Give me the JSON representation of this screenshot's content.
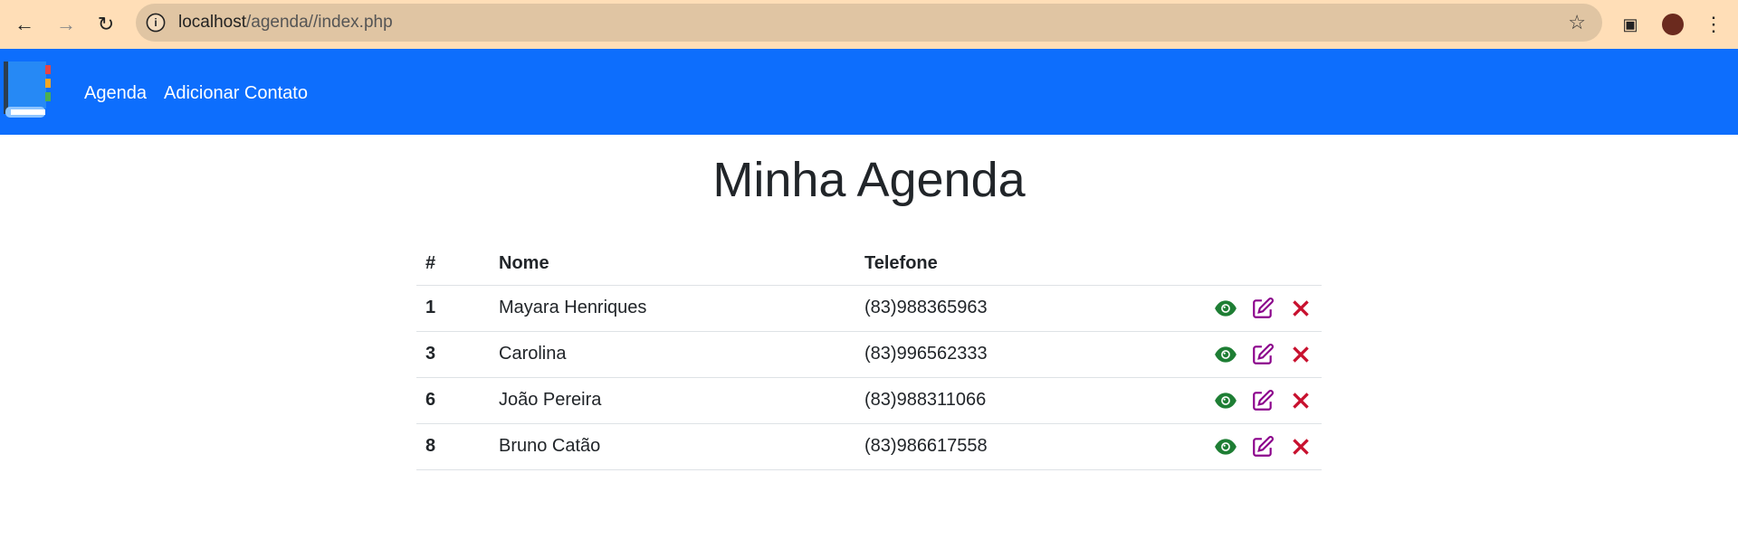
{
  "browser": {
    "url_host": "localhost",
    "url_path": "/agenda//index.php"
  },
  "navbar": {
    "links": [
      "Agenda",
      "Adicionar Contato"
    ]
  },
  "page": {
    "title": "Minha Agenda"
  },
  "table": {
    "headers": [
      "#",
      "Nome",
      "Telefone"
    ],
    "rows": [
      {
        "id": "1",
        "nome": "Mayara Henriques",
        "telefone": "(83)988365963"
      },
      {
        "id": "3",
        "nome": "Carolina",
        "telefone": "(83)996562333"
      },
      {
        "id": "6",
        "nome": "João Pereira",
        "telefone": "(83)988311066"
      },
      {
        "id": "8",
        "nome": "Bruno Catão",
        "telefone": "(83)986617558"
      }
    ]
  },
  "colors": {
    "navbar": "#0d6efd",
    "view": "#1e7e34",
    "edit": "#8b008b",
    "delete": "#c8102e"
  }
}
